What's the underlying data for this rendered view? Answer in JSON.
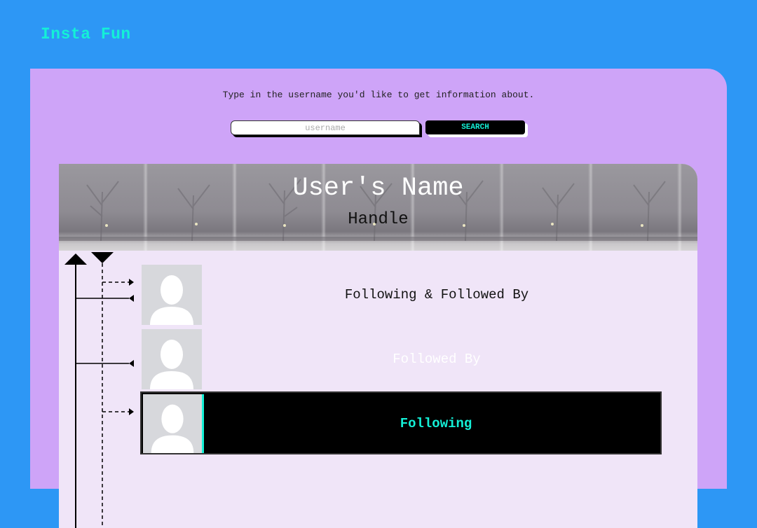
{
  "app": {
    "title": "Insta Fun"
  },
  "search": {
    "instruction": "Type in the username you'd like to get information about.",
    "placeholder": "username",
    "button_label": "SEARCH"
  },
  "profile": {
    "name": "User's Name",
    "handle": "Handle"
  },
  "relations": [
    {
      "label": "Following & Followed By",
      "type": "mutual"
    },
    {
      "label": "Followed By",
      "type": "follower"
    },
    {
      "label": "Following",
      "type": "following"
    }
  ],
  "colors": {
    "background": "#2d97f5",
    "panel": "#cea4f8",
    "card": "#f0e5f8",
    "accent": "#14f0d7",
    "dark": "#000000"
  },
  "icons": {
    "avatar": "user-placeholder-icon",
    "up_arrow": "arrow-up-icon",
    "down_arrow": "arrow-down-icon"
  }
}
